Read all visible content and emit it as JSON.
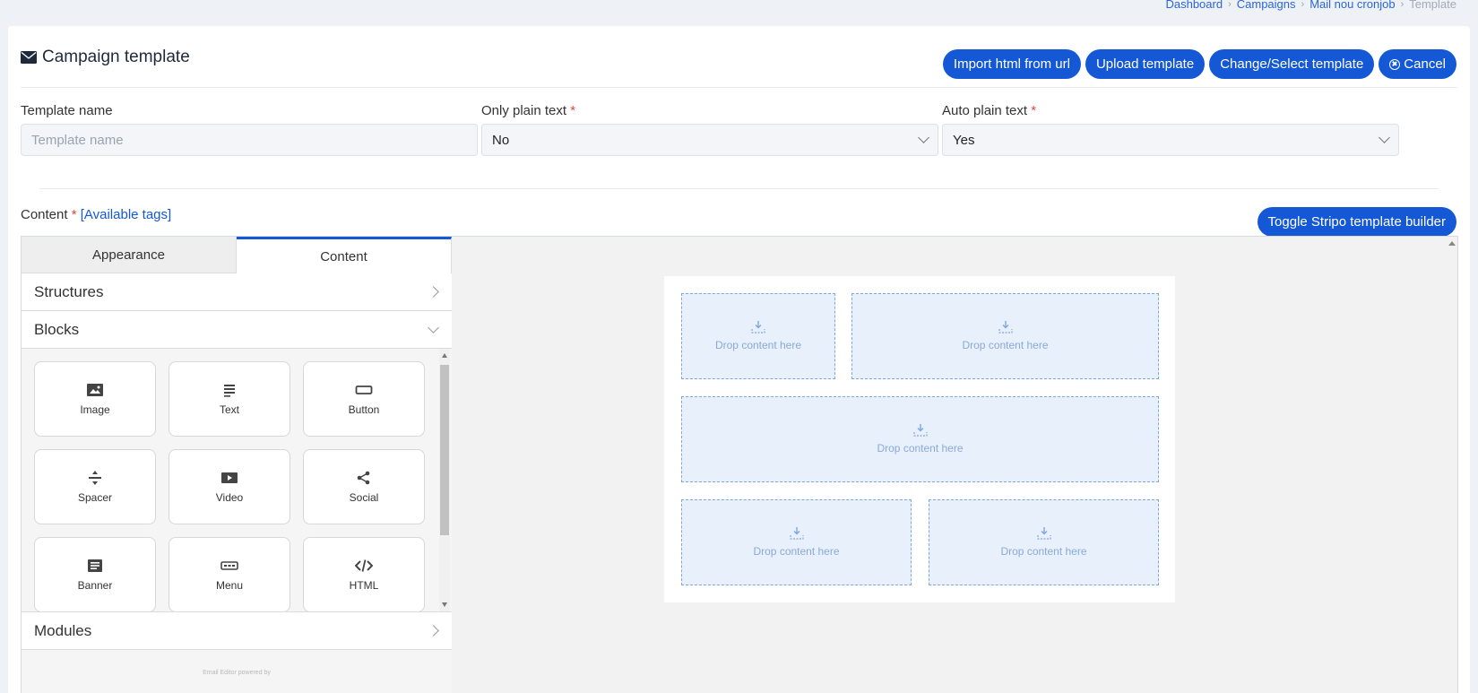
{
  "breadcrumb": [
    "Dashboard",
    "Campaigns",
    "Mail nou cronjob",
    "Template"
  ],
  "header": {
    "title": "Campaign template",
    "icon": "envelope-icon"
  },
  "actions": {
    "import": "Import html from url",
    "upload": "Upload template",
    "change": "Change/Select template",
    "cancel": "Cancel"
  },
  "form": {
    "template_name": {
      "label": "Template name",
      "placeholder": "Template name",
      "value": ""
    },
    "only_plain": {
      "label": "Only plain text",
      "required": "*",
      "value": "No"
    },
    "auto_plain": {
      "label": "Auto plain text",
      "required": "*",
      "value": "Yes"
    }
  },
  "content": {
    "label": "Content",
    "required": "*",
    "tags_link": "[Available tags]"
  },
  "toggle_label": "Toggle Stripo template builder",
  "editor": {
    "tabs": [
      "Appearance",
      "Content"
    ],
    "active_tab": "Content",
    "sections": {
      "structures": "Structures",
      "blocks": "Blocks",
      "modules": "Modules"
    },
    "blocks": [
      {
        "label": "Image",
        "icon": "image-icon"
      },
      {
        "label": "Text",
        "icon": "text-icon"
      },
      {
        "label": "Button",
        "icon": "button-icon"
      },
      {
        "label": "Spacer",
        "icon": "spacer-icon"
      },
      {
        "label": "Video",
        "icon": "video-icon"
      },
      {
        "label": "Social",
        "icon": "share-icon"
      },
      {
        "label": "Banner",
        "icon": "banner-icon"
      },
      {
        "label": "Menu",
        "icon": "menu-icon"
      },
      {
        "label": "HTML",
        "icon": "code-icon"
      }
    ],
    "footer_note": "Email Editor powered by",
    "drop_text": "Drop content here"
  }
}
